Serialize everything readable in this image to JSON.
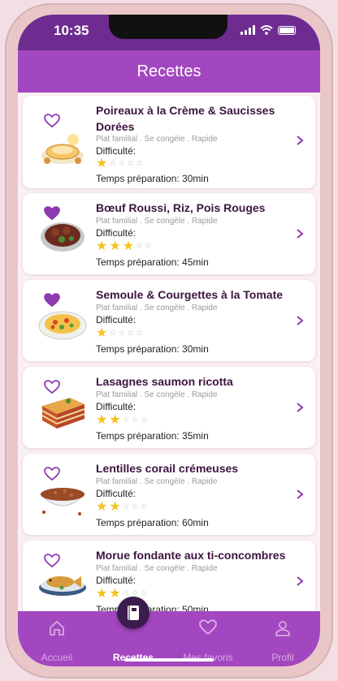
{
  "status_bar": {
    "time": "10:35"
  },
  "header": {
    "title": "Recettes"
  },
  "recipes": [
    {
      "title": "Poireaux à la Crème & Saucisses Dorées",
      "tags": "Plat familial . Se congèle . Rapide",
      "difficulty_label": "Difficulté:",
      "difficulty": 1,
      "prep_time": "Temps préparation: 30min",
      "favorite": false,
      "icon": "soup-plate-icon"
    },
    {
      "title": "Bœuf Roussi, Riz, Pois Rouges",
      "tags": "Plat familial . Se congèle . Rapide",
      "difficulty_label": "Difficulté:",
      "difficulty": 3,
      "prep_time": "Temps préparation: 45min",
      "favorite": true,
      "icon": "stew-bowl-icon"
    },
    {
      "title": "Semoule & Courgettes à la Tomate",
      "tags": "Plat familial . Se congèle . Rapide",
      "difficulty_label": "Difficulté:",
      "difficulty": 1,
      "prep_time": "Temps préparation: 30min",
      "favorite": true,
      "icon": "semolina-plate-icon"
    },
    {
      "title": "Lasagnes saumon ricotta",
      "tags": "Plat familial . Se congèle . Rapide",
      "difficulty_label": "Difficulté:",
      "difficulty": 2,
      "prep_time": "Temps préparation: 35min",
      "favorite": false,
      "icon": "lasagna-icon"
    },
    {
      "title": "Lentilles corail crémeuses",
      "tags": "Plat familial . Se congèle . Rapide",
      "difficulty_label": "Difficulté:",
      "difficulty": 2,
      "prep_time": "Temps préparation: 60min",
      "favorite": false,
      "icon": "lentil-bowl-icon"
    },
    {
      "title": "Morue fondante aux ti-concombres",
      "tags": "Plat familial . Se congèle . Rapide",
      "difficulty_label": "Difficulté:",
      "difficulty": 2,
      "prep_time": "Temps préparation: 50min",
      "favorite": false,
      "icon": "fish-plate-icon"
    }
  ],
  "nav": [
    {
      "label": "Accueil",
      "icon": "home-icon",
      "active": false
    },
    {
      "label": "Recettes",
      "icon": "recipe-book-icon",
      "active": true
    },
    {
      "label": "Mes favoris",
      "icon": "heart-icon",
      "active": false
    },
    {
      "label": "Profil",
      "icon": "user-icon",
      "active": false
    }
  ],
  "colors": {
    "header": "#a347c0",
    "status_bar": "#6e2c91",
    "title_text": "#3d1440",
    "star": "#f4c21b",
    "heart": "#8e3ab0",
    "chevron": "#8e3ab0"
  }
}
